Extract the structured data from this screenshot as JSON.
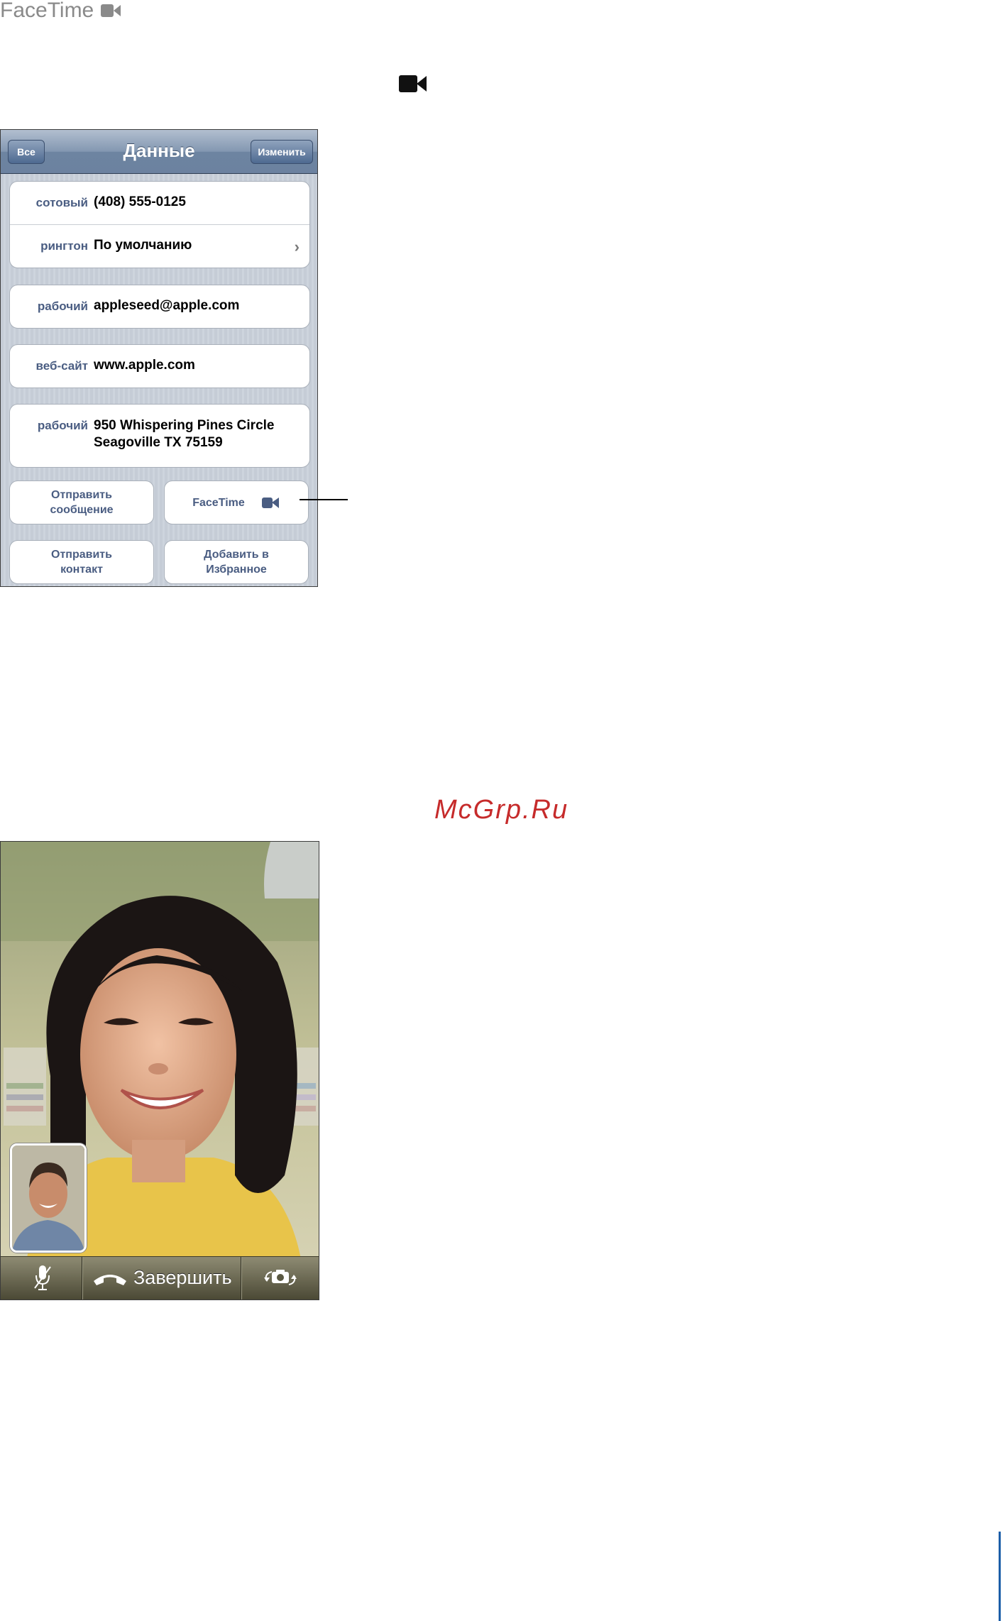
{
  "header": {
    "title": "FaceTime",
    "icon": "video-camera-icon"
  },
  "contact_screen": {
    "nav": {
      "back_label": "Все",
      "title": "Данные",
      "edit_label": "Изменить"
    },
    "fields": [
      {
        "label": "сотовый",
        "value": "(408) 555-0125"
      },
      {
        "label": "рингтон",
        "value": "По умолчанию",
        "chevron": "›"
      },
      {
        "label": "рабочий",
        "value": "appleseed@apple.com"
      },
      {
        "label": "веб-сайт",
        "value": "www.apple.com"
      },
      {
        "label": "рабочий",
        "value_line1": "950 Whispering Pines Circle",
        "value_line2": "Seagoville TX 75159"
      }
    ],
    "buttons": {
      "send_message": {
        "line1": "Отправить",
        "line2": "сообщение"
      },
      "facetime": "FaceTime",
      "share_contact": {
        "line1": "Отправить",
        "line2": "контакт"
      },
      "add_favorites": {
        "line1": "Добавить в",
        "line2": "Избранное"
      }
    }
  },
  "watermark": "McGrp.Ru",
  "call_screen": {
    "end_label": "Завершить"
  },
  "colors": {
    "accent": "#4a5d82",
    "watermark": "#c62b2b",
    "page_rule": "#1c5ea8"
  }
}
